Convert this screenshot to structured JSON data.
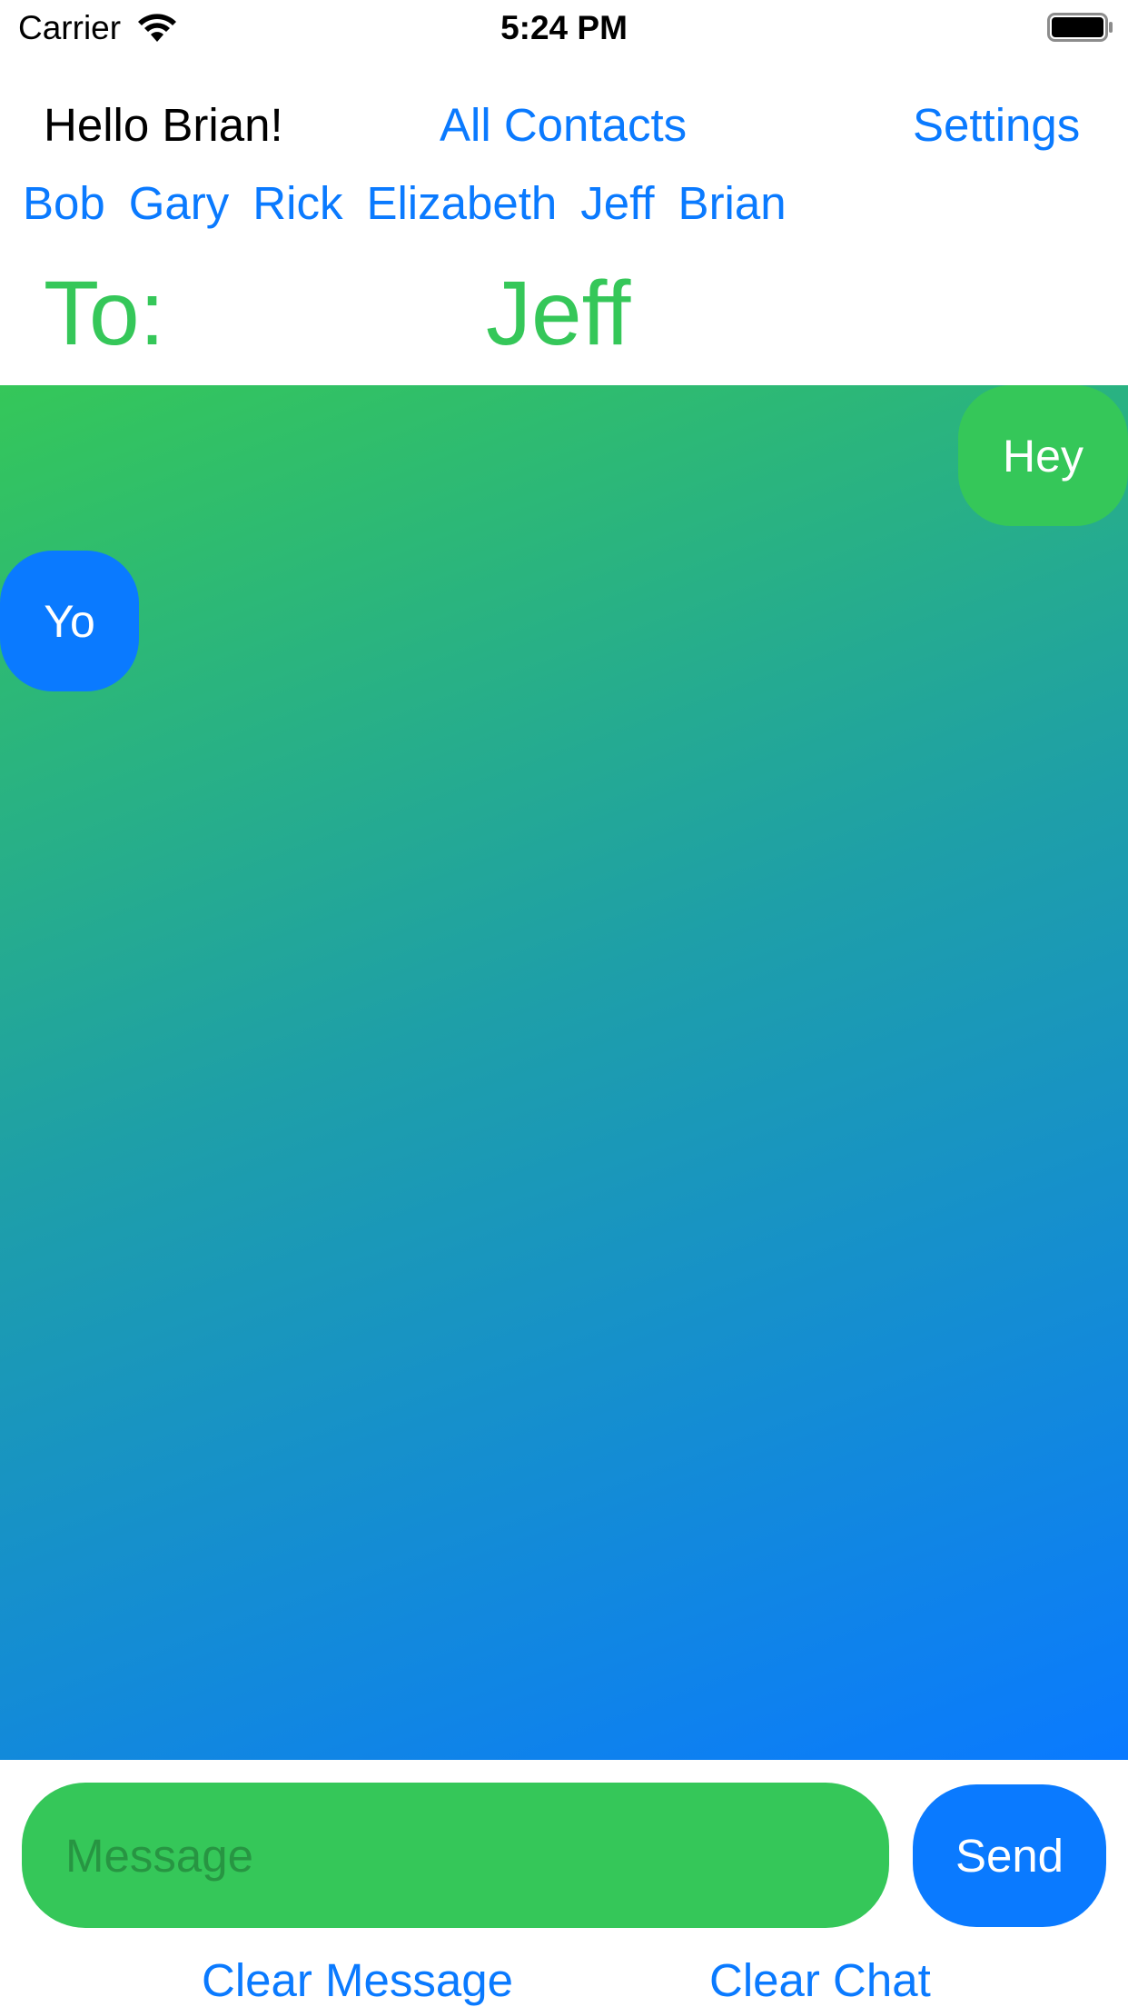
{
  "status_bar": {
    "carrier": "Carrier",
    "time": "5:24 PM",
    "wifi_icon": "wifi-icon",
    "battery_icon": "battery-icon"
  },
  "header": {
    "greeting": "Hello Brian!",
    "all_contacts": "All Contacts",
    "settings": "Settings"
  },
  "contacts": [
    "Bob",
    "Gary",
    "Rick",
    "Elizabeth",
    "Jeff",
    "Brian"
  ],
  "recipient": {
    "label": "To:",
    "name": "Jeff"
  },
  "messages": [
    {
      "text": "Hey",
      "direction": "sent",
      "color": "#35c759"
    },
    {
      "text": "Yo",
      "direction": "received",
      "color": "#0a7aff"
    }
  ],
  "composer": {
    "placeholder": "Message",
    "value": "",
    "send_label": "Send",
    "clear_message_label": "Clear Message",
    "clear_chat_label": "Clear Chat"
  },
  "colors": {
    "accent_blue": "#0a7aff",
    "accent_green": "#35c759"
  }
}
